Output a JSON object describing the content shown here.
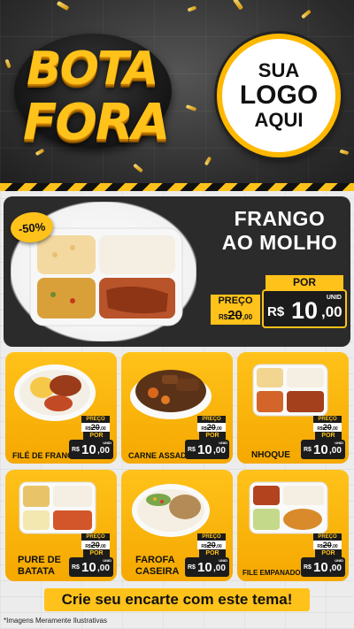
{
  "header": {
    "title_line1": "BOTA",
    "title_line2": "FORA",
    "logo_line1": "SUA",
    "logo_line2": "LOGO",
    "logo_line3": "AQUI"
  },
  "featured": {
    "discount": "-50%",
    "name_line1": "FRANGO",
    "name_line2": "AO MOLHO",
    "price_label": "PREÇO",
    "old_price_main": "20",
    "old_price_cents": ",00",
    "old_currency": "R$",
    "por_label": "POR",
    "currency": "R$",
    "price_main": "10",
    "price_cents": ",00",
    "unit": "UNID"
  },
  "items": [
    {
      "name": "FILÉ DE FRANGO",
      "price_label": "PREÇO",
      "old_main": "20",
      "old_cents": ",00",
      "old_currency": "R$",
      "por": "POR",
      "currency": "R$",
      "main": "10",
      "cents": ",00",
      "unit": "UNID"
    },
    {
      "name": "CARNE ASSADA",
      "price_label": "PREÇO",
      "old_main": "20",
      "old_cents": ",00",
      "old_currency": "R$",
      "por": "POR",
      "currency": "R$",
      "main": "10",
      "cents": ",00",
      "unit": "UNID"
    },
    {
      "name": "NHOQUE",
      "price_label": "PREÇO",
      "old_main": "20",
      "old_cents": ",00",
      "old_currency": "R$",
      "por": "POR",
      "currency": "R$",
      "main": "10",
      "cents": ",00",
      "unit": "UNID"
    },
    {
      "name_line1": "PURE DE",
      "name_line2": "BATATA",
      "price_label": "PREÇO",
      "old_main": "20",
      "old_cents": ",00",
      "old_currency": "R$",
      "por": "POR",
      "currency": "R$",
      "main": "10",
      "cents": ",00",
      "unit": "UNID"
    },
    {
      "name_line1": "FAROFA",
      "name_line2": "CASEIRA",
      "price_label": "PREÇO",
      "old_main": "20",
      "old_cents": ",00",
      "old_currency": "R$",
      "por": "POR",
      "currency": "R$",
      "main": "10",
      "cents": ",00",
      "unit": "UNID"
    },
    {
      "name": "FILE EMPANADO",
      "price_label": "PREÇO",
      "old_main": "20",
      "old_cents": ",00",
      "old_currency": "R$",
      "por": "POR",
      "currency": "R$",
      "main": "10",
      "cents": ",00",
      "unit": "UNID"
    }
  ],
  "cta": "Crie seu encarte com este tema!",
  "disclaimer": "*Imagens Meramente Ilustrativas",
  "colors": {
    "accent": "#ffc21a",
    "dark": "#1c1c1c",
    "card_bg": "#2b2b2b"
  }
}
